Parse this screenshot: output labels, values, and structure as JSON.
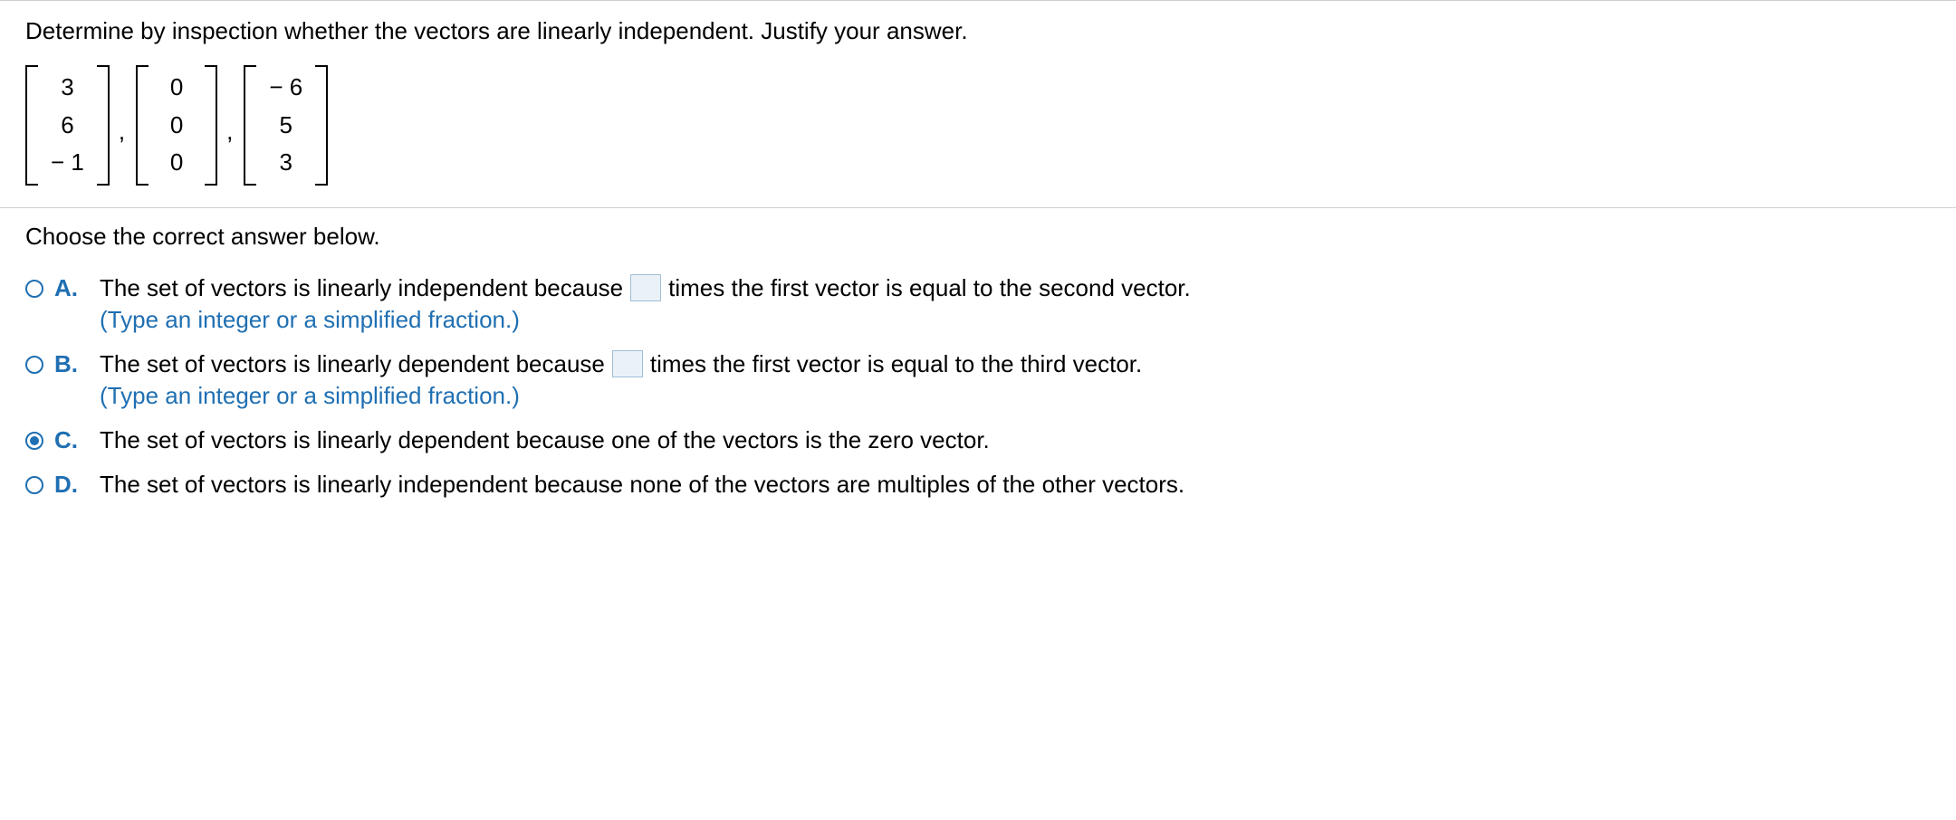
{
  "question": {
    "prompt": "Determine by inspection whether the vectors are linearly independent. Justify your answer.",
    "vectors": {
      "v1": [
        "3",
        "6",
        "− 1"
      ],
      "v2": [
        "0",
        "0",
        "0"
      ],
      "v3": [
        "− 6",
        "5",
        "3"
      ]
    },
    "comma": ","
  },
  "choose_label": "Choose the correct answer below.",
  "options": {
    "A": {
      "letter": "A.",
      "text_before": "The set of vectors is linearly independent because ",
      "text_after": " times the first vector is equal to the second vector.",
      "hint": "(Type an integer or a simplified fraction.)",
      "has_input": true,
      "selected": false
    },
    "B": {
      "letter": "B.",
      "text_before": "The set of vectors is linearly dependent because ",
      "text_after": " times the first vector is equal to the third vector.",
      "hint": "(Type an integer or a simplified fraction.)",
      "has_input": true,
      "selected": false
    },
    "C": {
      "letter": "C.",
      "text": "The set of vectors is linearly dependent because one of the vectors is the zero vector.",
      "has_input": false,
      "selected": true
    },
    "D": {
      "letter": "D.",
      "text": "The set of vectors is linearly independent because none of the vectors are multiples of the other vectors.",
      "has_input": false,
      "selected": false
    }
  }
}
